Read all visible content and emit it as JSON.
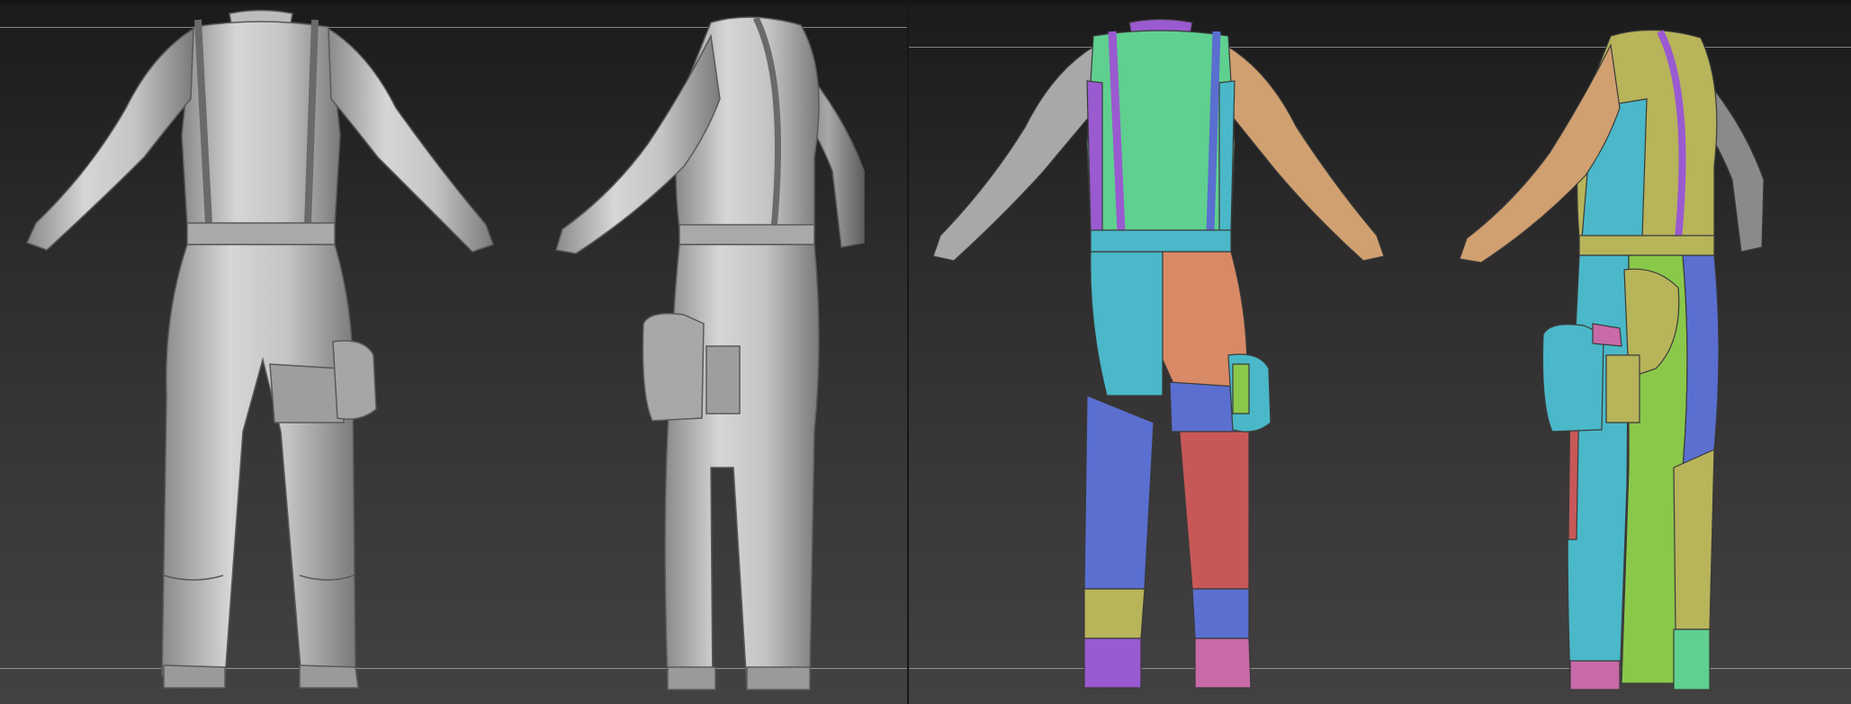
{
  "scene": {
    "viewports": [
      {
        "name": "sculpt-view",
        "shading": "matcap-gray"
      },
      {
        "name": "polygroups-view",
        "shading": "polygroup-colors"
      }
    ],
    "colors": {
      "matcap_light": "#d9d9d9",
      "matcap_mid": "#b4b4b4",
      "matcap_dark": "#7c7c7c",
      "background_top": "#1b1b1b",
      "background_bottom": "#434141",
      "group_green": "#5fd08f",
      "group_cyan": "#4ab8c8",
      "group_blue": "#5a6fd0",
      "group_salmon": "#d88a66",
      "group_red": "#c85858",
      "group_yellow": "#b8b45a",
      "group_purple": "#9a5ad0",
      "group_pink": "#c86aa8",
      "group_tan": "#d0a070",
      "group_lime": "#8ac84a",
      "group_gray": "#9a9a9a"
    }
  }
}
